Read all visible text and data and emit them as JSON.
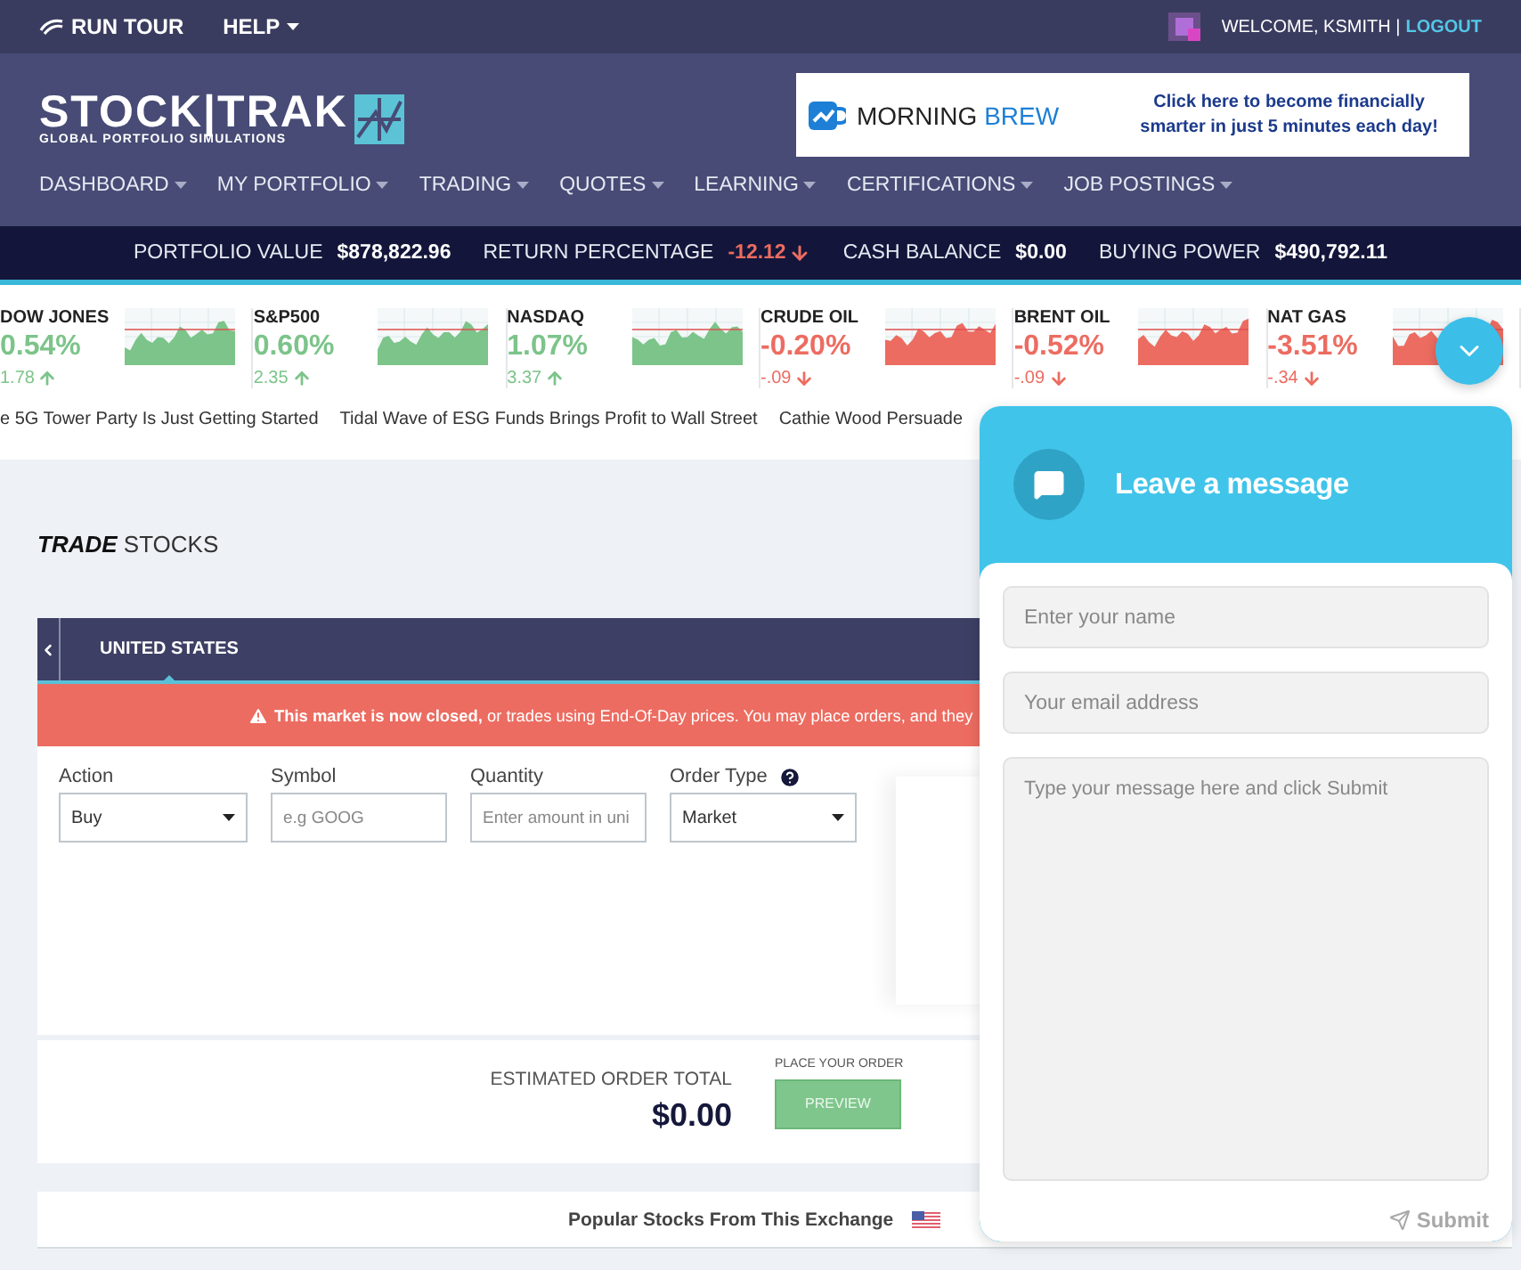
{
  "top_bar": {
    "run_tour": "RUN TOUR",
    "help": "HELP",
    "welcome": "WELCOME, KSMITH",
    "separator": "|",
    "logout": "LOGOUT"
  },
  "logo": {
    "name": "STOCK|TRAK",
    "tagline": "GLOBAL PORTFOLIO SIMULATIONS"
  },
  "ad": {
    "brand_first": "MORNING",
    "brand_second": "BREW",
    "message": "Click here to become financially smarter in just 5 minutes each day!"
  },
  "nav": [
    "DASHBOARD",
    "MY PORTFOLIO",
    "TRADING",
    "QUOTES",
    "LEARNING",
    "CERTIFICATIONS",
    "JOB POSTINGS"
  ],
  "stats": [
    {
      "label": "PORTFOLIO VALUE",
      "value": "$878,822.96",
      "kind": "plain"
    },
    {
      "label": "RETURN PERCENTAGE",
      "value": "-12.12",
      "kind": "down"
    },
    {
      "label": "CASH BALANCE",
      "value": "$0.00",
      "kind": "plain"
    },
    {
      "label": "BUYING POWER",
      "value": "$490,792.11",
      "kind": "plain"
    }
  ],
  "tickers": [
    {
      "name": "DOW JONES",
      "percent": "0.54%",
      "change": "1.78",
      "kind": "up"
    },
    {
      "name": "S&P500",
      "percent": "0.60%",
      "change": "2.35",
      "kind": "up"
    },
    {
      "name": "NASDAQ",
      "percent": "1.07%",
      "change": "3.37",
      "kind": "up"
    },
    {
      "name": "CRUDE OIL",
      "percent": "-0.20%",
      "change": "-.09",
      "kind": "down"
    },
    {
      "name": "BRENT OIL",
      "percent": "-0.52%",
      "change": "-.09",
      "kind": "down"
    },
    {
      "name": "NAT GAS",
      "percent": "-3.51%",
      "change": "-.34",
      "kind": "down"
    }
  ],
  "news": [
    "e 5G Tower Party Is Just Getting Started",
    "Tidal Wave of ESG Funds Brings Profit to Wall Street",
    "Cathie Wood Persuade"
  ],
  "page_title": {
    "emphasis": "TRADE",
    "rest": "STOCKS"
  },
  "market_tabs": [
    {
      "label": "UNITED STATES",
      "selected": true
    }
  ],
  "alert": "**This market is now closed,** or trades using End-Of-Day prices. You may place orders, and they",
  "fields": [
    {
      "kind": "select",
      "label": "Action",
      "value": "Buy"
    },
    {
      "kind": "input",
      "label": "Symbol",
      "placeholder": "e.g GOOG"
    },
    {
      "kind": "input",
      "label": "Quantity",
      "placeholder": "Enter amount in uni"
    },
    {
      "kind": "select",
      "label": "Order Type",
      "value": "Market",
      "help": true
    }
  ],
  "order": {
    "label": "ESTIMATED ORDER TOTAL",
    "total": "$0.00",
    "place_label": "PLACE YOUR ORDER",
    "button": "PREVIEW"
  },
  "popular": {
    "title": "Popular Stocks From This Exchange"
  },
  "chat": {
    "title": "Leave a message",
    "name_placeholder": "Enter your name",
    "email_placeholder": "Your email address",
    "message_placeholder": "Type your message here and click Submit",
    "submit": "Submit"
  }
}
